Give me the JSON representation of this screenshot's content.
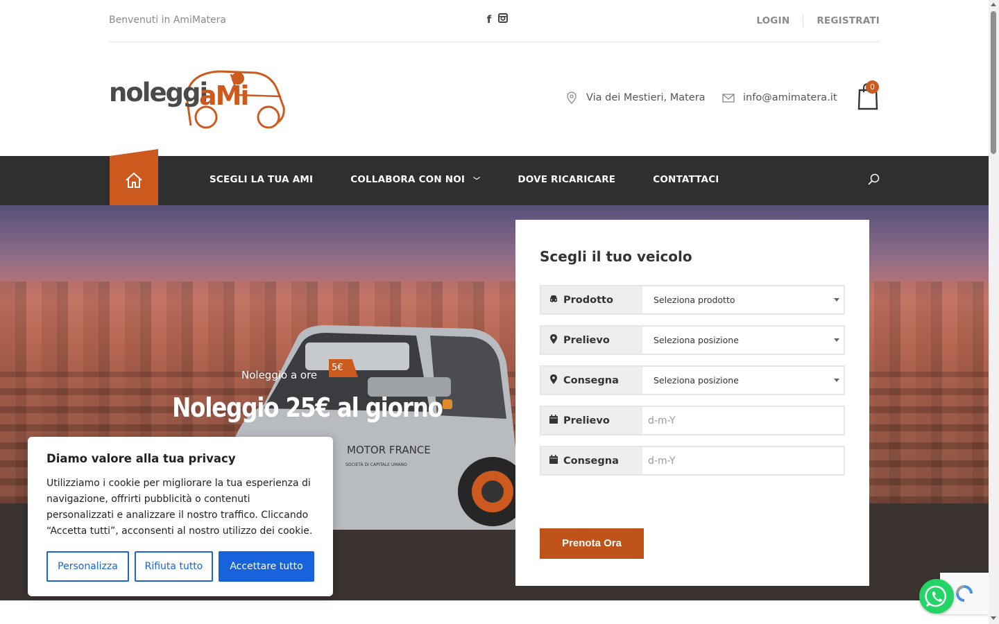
{
  "topbar": {
    "welcome": "Benvenuti in AmiMatera",
    "social": [
      {
        "icon": "facebook-icon",
        "glyph": "f"
      },
      {
        "icon": "instagram-icon",
        "glyph": "◙"
      }
    ],
    "login": "LOGIN",
    "register": "REGISTRATI"
  },
  "header": {
    "logo_text_dark": "noleggi",
    "logo_text_accent": "aMi",
    "address": "Via dei Mestieri, Matera",
    "email": "info@amimatera.it",
    "cart_count": "0"
  },
  "nav": {
    "items": [
      {
        "label": "SCEGLI LA TUA AMI"
      },
      {
        "label": "COLLABORA CON NOI",
        "dropdown": true
      },
      {
        "label": "DOVE RICARICARE"
      },
      {
        "label": "CONTATTACI"
      }
    ]
  },
  "hero": {
    "small": "Noleggio a ore",
    "price_tag": "5€",
    "big": "Noleggio 25€ al giorno",
    "car_brand": "MOTOR FRANCE",
    "car_sub": "SOCIETÀ DI CAPITALE UMANO"
  },
  "booking": {
    "title": "Scegli il tuo veicolo",
    "fields": [
      {
        "icon": "car-icon",
        "label": "Prodotto",
        "value": "Seleziona prodotto",
        "type": "select"
      },
      {
        "icon": "map-marker-icon",
        "label": "Prelievo",
        "value": "Seleziona posizione",
        "type": "select"
      },
      {
        "icon": "map-marker-icon",
        "label": "Consegna",
        "value": "Seleziona posizione",
        "type": "select"
      },
      {
        "icon": "calendar-icon",
        "label": "Prelievo",
        "placeholder": "d-m-Y",
        "type": "date"
      },
      {
        "icon": "calendar-icon",
        "label": "Consegna",
        "placeholder": "d-m-Y",
        "type": "date"
      }
    ],
    "submit": "Prenota Ora"
  },
  "cookie": {
    "title": "Diamo valore alla tua privacy",
    "text": "Utilizziamo i cookie per migliorare la tua esperienza di navigazione, offrirti pubblicità o contenuti personalizzati e analizzare il nostro traffico. Cliccando “Accetta tutti”, acconsenti al nostro utilizzo dei cookie.",
    "customize": "Personalizza",
    "reject": "Rifiuta tutto",
    "accept": "Accettare tutto"
  },
  "colors": {
    "accent": "#cc5a1e",
    "nav_bg": "#2f2f2f",
    "cookie_blue": "#1863dc",
    "whatsapp": "#25d366"
  }
}
